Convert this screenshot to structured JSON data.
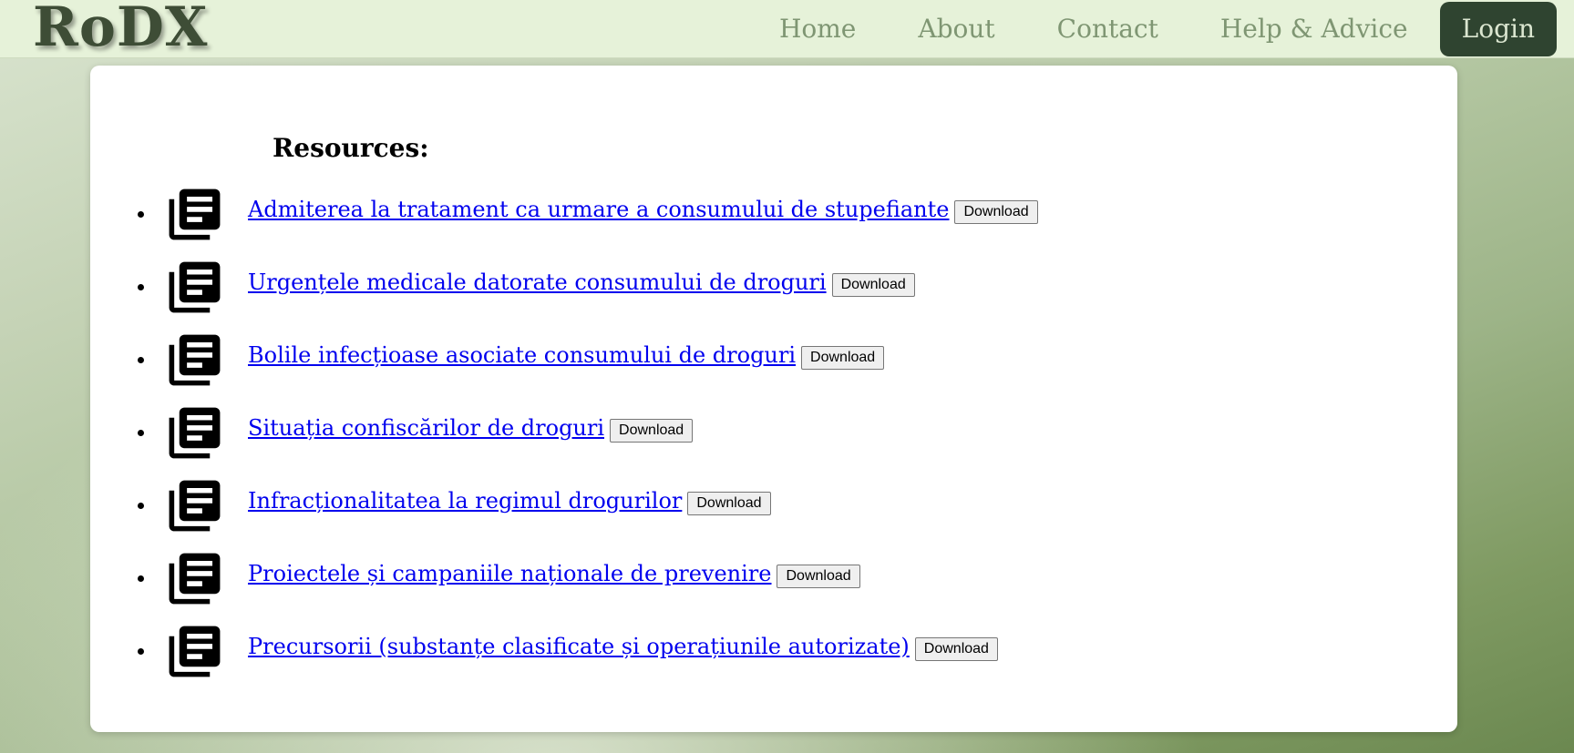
{
  "header": {
    "logo": "RoDX",
    "nav": {
      "home": "Home",
      "about": "About",
      "contact": "Contact",
      "help": "Help & Advice"
    },
    "login_label": "Login"
  },
  "main": {
    "title": "Resources:",
    "download_label": "Download",
    "resources": [
      {
        "label": "Admiterea la tratament ca urmare a consumului de stupefiante",
        "icon": "document-icon"
      },
      {
        "label": "Urgențele medicale datorate consumului de droguri",
        "icon": "document-icon"
      },
      {
        "label": "Bolile infecțioase asociate consumului de droguri",
        "icon": "document-icon"
      },
      {
        "label": "Situația confiscărilor de droguri",
        "icon": "document-icon"
      },
      {
        "label": "Infracționalitatea la regimul drogurilor",
        "icon": "document-icon"
      },
      {
        "label": "Proiectele și campaniile naționale de prevenire",
        "icon": "document-icon"
      },
      {
        "label": "Precursorii (substanțe clasificate și operațiunile autorizate)",
        "icon": "document-icon"
      }
    ]
  },
  "colors": {
    "navbar_bg": "#e6f2d9",
    "logo": "#3e4d36",
    "nav_link": "#7f9673",
    "login_bg": "#2f4430",
    "link": "#0000ee"
  }
}
